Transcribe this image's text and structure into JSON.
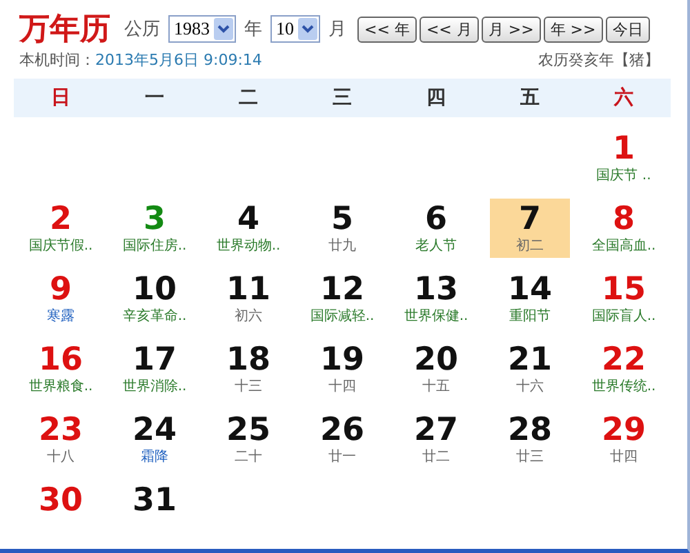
{
  "title": "万年历",
  "controls": {
    "calendar_label": "公历",
    "year": "1983",
    "year_unit": "年",
    "month": "10",
    "month_unit": "月",
    "buttons": [
      "<< 年",
      "<< 月",
      "月 >>",
      "年 >>",
      "今日"
    ]
  },
  "clock": {
    "label": "本机时间：",
    "value": "2013年5月6日 9:09:14"
  },
  "lunar_year": "农历癸亥年【猪】",
  "weekdays": [
    {
      "label": "日",
      "weekend": true
    },
    {
      "label": "一",
      "weekend": false
    },
    {
      "label": "二",
      "weekend": false
    },
    {
      "label": "三",
      "weekend": false
    },
    {
      "label": "四",
      "weekend": false
    },
    {
      "label": "五",
      "weekend": false
    },
    {
      "label": "六",
      "weekend": true
    }
  ],
  "weeks": [
    [
      {
        "day": "1",
        "color": "#dd1111",
        "note": "国庆节 ..",
        "kind": "festival",
        "selected": false
      }
    ],
    [
      {
        "day": "2",
        "color": "#dd1111",
        "note": "国庆节假..",
        "kind": "festival",
        "selected": false
      },
      {
        "day": "3",
        "color": "#138a13",
        "note": "国际住房..",
        "kind": "festival",
        "selected": false
      },
      {
        "day": "4",
        "color": "#111111",
        "note": "世界动物..",
        "kind": "festival",
        "selected": false
      },
      {
        "day": "5",
        "color": "#111111",
        "note": "廿九",
        "kind": "lunar",
        "selected": false
      },
      {
        "day": "6",
        "color": "#111111",
        "note": "老人节",
        "kind": "festival",
        "selected": false
      },
      {
        "day": "7",
        "color": "#111111",
        "note": "初二",
        "kind": "lunar",
        "selected": true
      },
      {
        "day": "8",
        "color": "#dd1111",
        "note": "全国高血..",
        "kind": "festival",
        "selected": false
      }
    ],
    [
      {
        "day": "9",
        "color": "#dd1111",
        "note": "寒露",
        "kind": "term",
        "selected": false
      },
      {
        "day": "10",
        "color": "#111111",
        "note": "辛亥革命..",
        "kind": "festival",
        "selected": false
      },
      {
        "day": "11",
        "color": "#111111",
        "note": "初六",
        "kind": "lunar",
        "selected": false
      },
      {
        "day": "12",
        "color": "#111111",
        "note": "国际减轻..",
        "kind": "festival",
        "selected": false
      },
      {
        "day": "13",
        "color": "#111111",
        "note": "世界保健..",
        "kind": "festival",
        "selected": false
      },
      {
        "day": "14",
        "color": "#111111",
        "note": "重阳节",
        "kind": "festival",
        "selected": false
      },
      {
        "day": "15",
        "color": "#dd1111",
        "note": "国际盲人..",
        "kind": "festival",
        "selected": false
      }
    ],
    [
      {
        "day": "16",
        "color": "#dd1111",
        "note": "世界粮食..",
        "kind": "festival",
        "selected": false
      },
      {
        "day": "17",
        "color": "#111111",
        "note": "世界消除..",
        "kind": "festival",
        "selected": false
      },
      {
        "day": "18",
        "color": "#111111",
        "note": "十三",
        "kind": "lunar",
        "selected": false
      },
      {
        "day": "19",
        "color": "#111111",
        "note": "十四",
        "kind": "lunar",
        "selected": false
      },
      {
        "day": "20",
        "color": "#111111",
        "note": "十五",
        "kind": "lunar",
        "selected": false
      },
      {
        "day": "21",
        "color": "#111111",
        "note": "十六",
        "kind": "lunar",
        "selected": false
      },
      {
        "day": "22",
        "color": "#dd1111",
        "note": "世界传统..",
        "kind": "festival",
        "selected": false
      }
    ],
    [
      {
        "day": "23",
        "color": "#dd1111",
        "note": "十八",
        "kind": "lunar",
        "selected": false
      },
      {
        "day": "24",
        "color": "#111111",
        "note": "霜降",
        "kind": "term",
        "selected": false
      },
      {
        "day": "25",
        "color": "#111111",
        "note": "二十",
        "kind": "lunar",
        "selected": false
      },
      {
        "day": "26",
        "color": "#111111",
        "note": "廿一",
        "kind": "lunar",
        "selected": false
      },
      {
        "day": "27",
        "color": "#111111",
        "note": "廿二",
        "kind": "lunar",
        "selected": false
      },
      {
        "day": "28",
        "color": "#111111",
        "note": "廿三",
        "kind": "lunar",
        "selected": false
      },
      {
        "day": "29",
        "color": "#dd1111",
        "note": "廿四",
        "kind": "lunar",
        "selected": false
      }
    ],
    [
      {
        "day": "30",
        "color": "#dd1111",
        "selected": false
      },
      {
        "day": "31",
        "color": "#111111",
        "selected": false
      }
    ]
  ]
}
